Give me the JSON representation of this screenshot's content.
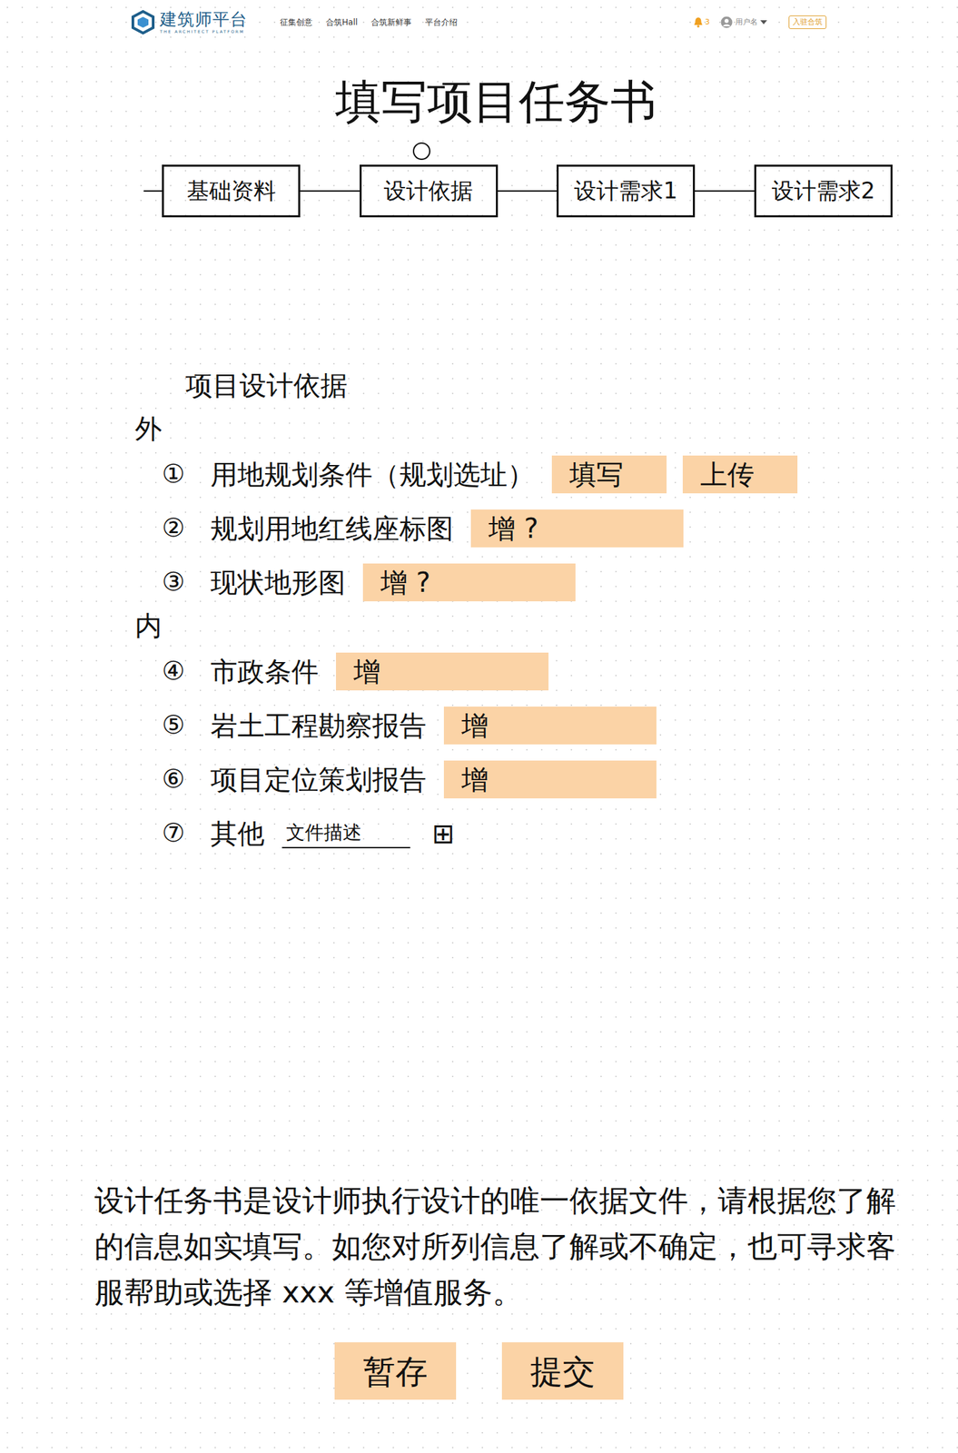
{
  "header": {
    "logo": {
      "title": "建筑师平台",
      "subtitle": "THE ARCHITECT PLATFORM"
    },
    "nav": [
      {
        "label": "征集创意",
        "selected": false
      },
      {
        "label": "合筑Hall",
        "selected": false
      },
      {
        "label": "合筑新鲜事",
        "selected": false
      },
      {
        "label": "平台介绍",
        "selected": false
      }
    ],
    "notifications": "3",
    "user": "用户名",
    "join_button": "入驻合筑"
  },
  "title": "填写项目任务书",
  "steps": [
    {
      "label": "基础资料",
      "selected": false
    },
    {
      "label": "设计依据",
      "selected": true
    },
    {
      "label": "设计需求1",
      "selected": false
    },
    {
      "label": "设计需求2",
      "selected": false
    }
  ],
  "basis": {
    "title": "项目设计依据",
    "groups": [
      {
        "label": "外",
        "items": [
          {
            "number": "①",
            "label": "用地规划条件（规划选址）",
            "kind": "actions",
            "actions": [
              "填写",
              "上传"
            ]
          },
          {
            "number": "②",
            "label": "规划用地红线座标图",
            "kind": "actions",
            "actions": [
              "增 ?"
            ]
          },
          {
            "number": "③",
            "label": "现状地形图",
            "kind": "actions",
            "actions": [
              "增 ?"
            ]
          }
        ]
      },
      {
        "label": "内",
        "items": [
          {
            "number": "④",
            "label": "市政条件",
            "kind": "actions",
            "actions": [
              "增"
            ]
          },
          {
            "number": "⑤",
            "label": "岩土工程勘察报告",
            "kind": "actions",
            "actions": [
              "增"
            ]
          },
          {
            "number": "⑥",
            "label": "项目定位策划报告",
            "kind": "actions",
            "actions": [
              "增"
            ]
          },
          {
            "number": "⑦",
            "label": "其他",
            "kind": "field",
            "value": "文件描述",
            "add": "⊞"
          }
        ]
      }
    ]
  },
  "note": "设计任务书是设计师执行设计的唯一依据文件，请根据您了解的信息如实填写。如您对所列信息了解或不确定，也可寻求客服帮助或选择 xxx 等增值服务。",
  "buttons": [
    "暂存",
    "提交"
  ]
}
